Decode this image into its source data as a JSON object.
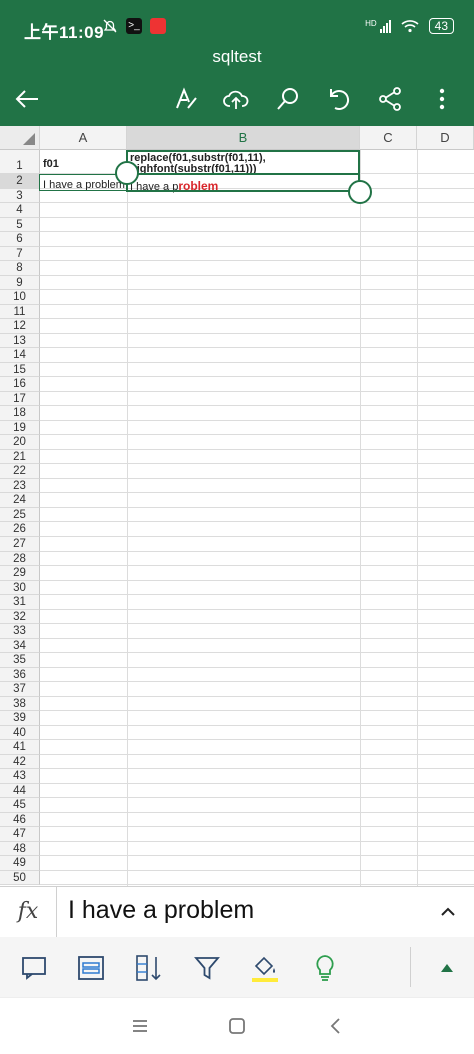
{
  "status": {
    "time": "上午11:09",
    "signal": "HD",
    "battery": "43"
  },
  "title": "sqltest",
  "columns": [
    "A",
    "B",
    "C",
    "D"
  ],
  "rows": [
    "1",
    "2",
    "3",
    "4",
    "5",
    "6",
    "7",
    "8",
    "9",
    "10",
    "11",
    "12",
    "13",
    "14",
    "15",
    "16",
    "17",
    "18",
    "19",
    "20",
    "21",
    "22",
    "23",
    "24",
    "25",
    "26",
    "27",
    "28",
    "29",
    "30",
    "31",
    "32",
    "33",
    "34",
    "35",
    "36",
    "37",
    "38",
    "39",
    "40",
    "41",
    "42",
    "43",
    "44",
    "45",
    "46",
    "47",
    "48",
    "49",
    "50"
  ],
  "cells": {
    "a1": "f01",
    "b1_line1": "replace(f01,substr(f01,11),",
    "b1_line2": "highfont(substr(f01,11)))",
    "a2": "I have a problem",
    "b2_plain": "I have a p",
    "b2_highlight": "roblem"
  },
  "formula": {
    "fx": "fx",
    "value": "I have a problem"
  },
  "colors": {
    "accent": "#217346",
    "highlight": "#d9262b",
    "fill_marker": "#ffeb3b"
  },
  "icons": {
    "toolbar": [
      "back-arrow-icon",
      "format-text-icon",
      "cloud-upload-icon",
      "search-icon",
      "undo-icon",
      "share-icon",
      "more-vertical-icon"
    ],
    "bottom": [
      "comment-icon",
      "table-icon",
      "sort-icon",
      "filter-icon",
      "fill-color-icon",
      "lightbulb-icon",
      "expand-up-icon"
    ]
  }
}
